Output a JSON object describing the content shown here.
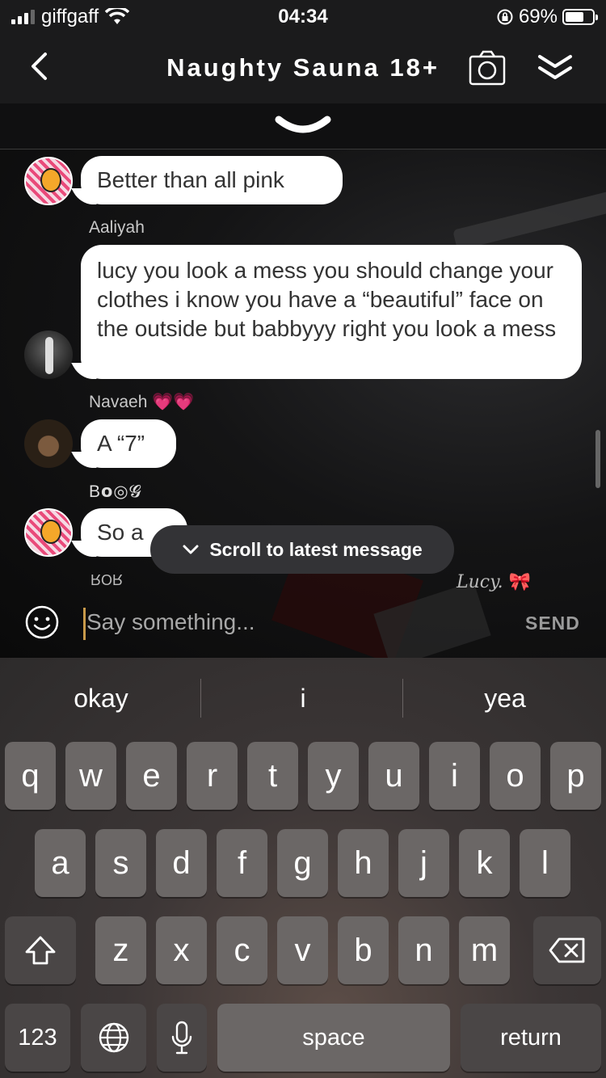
{
  "status_bar": {
    "carrier": "giffgaff",
    "time": "04:34",
    "battery": "69%",
    "battery_level": 0.69
  },
  "header": {
    "title": "Naughty Sauna 18+"
  },
  "messages": [
    {
      "text": "Better than all pink"
    },
    {
      "sender": "Aaliyah",
      "text": "lucy you look a mess you should change your clothes i know you have a “beautiful” face on the outside but babbyyy right you look a mess"
    },
    {
      "sender": "Navaeh",
      "sender_emoji": "💗💗",
      "text": "A “7”"
    },
    {
      "sender": "B𝗼◎𝓖",
      "text": "So a"
    }
  ],
  "scroll_prompt": "Scroll to latest message",
  "overlay_tags": {
    "left": "ROR",
    "right": "Lucy.",
    "right_emoji": "🎀"
  },
  "input": {
    "placeholder": "Say something...",
    "send_label": "SEND"
  },
  "keyboard": {
    "suggestions": [
      "okay",
      "i",
      "yea"
    ],
    "row1": [
      "q",
      "w",
      "e",
      "r",
      "t",
      "y",
      "u",
      "i",
      "o",
      "p"
    ],
    "row2": [
      "a",
      "s",
      "d",
      "f",
      "g",
      "h",
      "j",
      "k",
      "l"
    ],
    "row3": [
      "z",
      "x",
      "c",
      "v",
      "b",
      "n",
      "m"
    ],
    "numbers_label": "123",
    "space_label": "space",
    "return_label": "return"
  }
}
